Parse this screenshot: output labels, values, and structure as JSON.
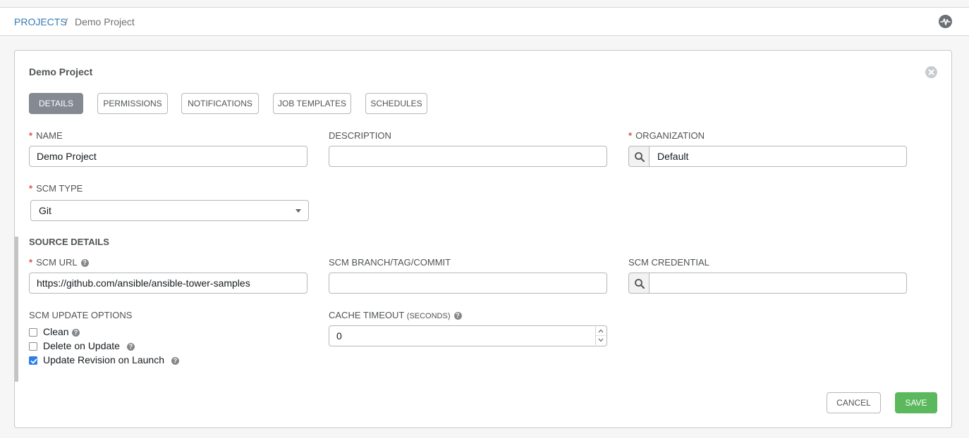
{
  "breadcrumb": {
    "projects_label": "PROJECTS",
    "separator": "/",
    "current": "Demo Project"
  },
  "header": {
    "activity_icon": "activity-stream-icon"
  },
  "panel": {
    "title": "Demo Project",
    "close_icon": "close-icon"
  },
  "tabs": [
    {
      "label": "DETAILS",
      "active": true
    },
    {
      "label": "PERMISSIONS",
      "active": false
    },
    {
      "label": "NOTIFICATIONS",
      "active": false
    },
    {
      "label": "JOB TEMPLATES",
      "active": false
    },
    {
      "label": "SCHEDULES",
      "active": false
    }
  ],
  "form": {
    "name": {
      "label": "NAME",
      "required": "*",
      "value": "Demo Project"
    },
    "description": {
      "label": "DESCRIPTION",
      "value": ""
    },
    "organization": {
      "label": "ORGANIZATION",
      "required": "*",
      "value": "Default"
    },
    "scm_type": {
      "label": "SCM TYPE",
      "required": "*",
      "value": "Git"
    },
    "source_details": {
      "title": "SOURCE DETAILS",
      "scm_url": {
        "label": "SCM URL",
        "required": "*",
        "value": "https://github.com/ansible/ansible-tower-samples"
      },
      "scm_branch": {
        "label": "SCM BRANCH/TAG/COMMIT",
        "value": ""
      },
      "scm_credential": {
        "label": "SCM CREDENTIAL",
        "value": ""
      },
      "update_options": {
        "label": "SCM UPDATE OPTIONS",
        "options": [
          {
            "label": "Clean",
            "checked": false
          },
          {
            "label": "Delete on Update",
            "checked": false
          },
          {
            "label": "Update Revision on Launch",
            "checked": true
          }
        ]
      },
      "cache_timeout": {
        "label": "CACHE TIMEOUT",
        "unit": "(SECONDS)",
        "value": "0"
      }
    }
  },
  "actions": {
    "cancel": "CANCEL",
    "save": "SAVE"
  },
  "colors": {
    "accent_link": "#337ab7",
    "save_green": "#5cb85c",
    "required_red": "#d9534f",
    "active_tab": "#848992",
    "checkbox_blue": "#2d7fe8"
  }
}
